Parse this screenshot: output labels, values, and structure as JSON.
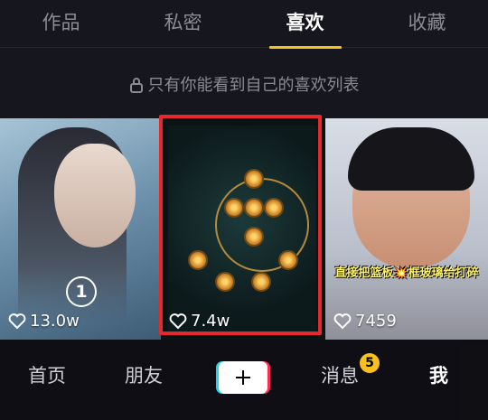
{
  "tabs": [
    {
      "label": "作品"
    },
    {
      "label": "私密"
    },
    {
      "label": "喜欢"
    },
    {
      "label": "收藏"
    }
  ],
  "active_tab": "喜欢",
  "privacy_note": "只有你能看到自己的喜欢列表",
  "videos": [
    {
      "likes": "13.0w",
      "badge": "1"
    },
    {
      "likes": "7.4w"
    },
    {
      "likes": "7459",
      "caption": "直接把篮板💥框玻璃给打碎"
    }
  ],
  "bottom_nav": {
    "home": "首页",
    "friends": "朋友",
    "messages": "消息",
    "messages_badge": "5",
    "me": "我"
  },
  "colors": {
    "accent": "#f5c515",
    "highlight_border": "#e8282c",
    "background": "#16161f"
  },
  "icons": [
    "lock-icon",
    "heart-icon",
    "plus-icon"
  ]
}
